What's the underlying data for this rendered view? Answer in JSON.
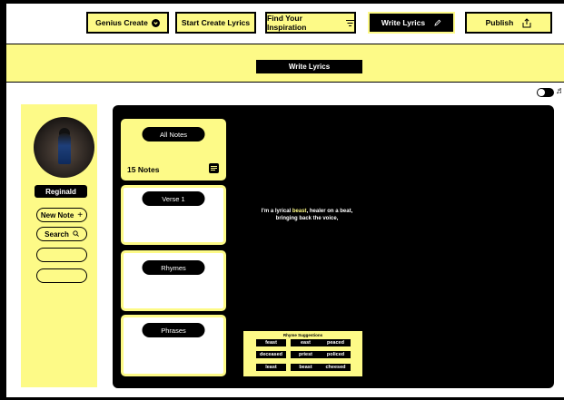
{
  "nav": {
    "genius_create": "Genius Create",
    "start_create_lyrics": "Start Create Lyrics",
    "find_inspiration": "Find Your Inspiration",
    "write_lyrics": "Write Lyrics",
    "publish": "Publish"
  },
  "banner": {
    "title": "Write Lyrics"
  },
  "sidebar": {
    "user_name": "Reginald",
    "new_note": "New Note",
    "search": "Search"
  },
  "cards": {
    "all_notes": "All Notes",
    "notes_count": "15 Notes",
    "verse": "Verse 1",
    "rhymes": "Rhymes",
    "phrases": "Phrases"
  },
  "lyrics": {
    "prefix": "I'm a lyrical ",
    "highlight": "beast",
    "suffix": ", healer on a beat,",
    "line2": "bringing back the voice,"
  },
  "rhymes": {
    "title": "Rhyme Suggestions",
    "words": [
      "feast",
      "east",
      "peaced",
      "deceased",
      "priest",
      "policed",
      "least",
      "beast",
      "cheesed"
    ]
  },
  "colors": {
    "accent": "#fdfa87",
    "dark": "#000000"
  },
  "icons": {
    "genius_create": "chevron-down-circle-icon",
    "find_inspiration": "filter-icon",
    "write_lyrics": "pencil-icon",
    "publish": "share-icon",
    "new_note": "plus-icon",
    "search": "search-icon",
    "notes": "notes-icon",
    "toggle": "toggle-icon",
    "music": "music-note-icon"
  }
}
